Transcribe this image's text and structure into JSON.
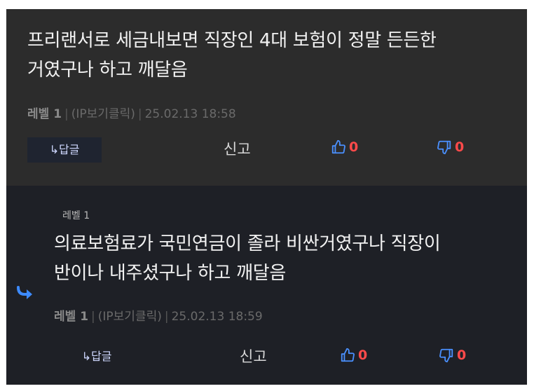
{
  "comments": [
    {
      "text_line1": "프리랜서로 세금내보면 직장인 4대 보험이 정말 든든한",
      "text_line2": "거였구나 하고 깨달음",
      "level": "레벨 1",
      "ip_toggle": "(IP보기클릭)",
      "date": "25.02.13 18:58",
      "reply_label": "↳답글",
      "report_label": "신고",
      "upvotes": "0",
      "downvotes": "0"
    },
    {
      "level_tag": "레벨 1",
      "text_line1": "의료보험료가 국민연금이 졸라 비싼거였구나  직장이",
      "text_line2": "반이나 내주셨구나 하고 깨달음",
      "level": "레벨 1",
      "ip_toggle": "(IP보기클릭)",
      "date": "25.02.13 18:59",
      "reply_label": "↳답글",
      "report_label": "신고",
      "upvotes": "0",
      "downvotes": "0"
    }
  ],
  "colors": {
    "count": "#ff4a4a",
    "thumb_up": "#4a90ff",
    "thumb_down": "#4a90ff",
    "reply_arrow": "#3d8bff"
  },
  "icons": [
    "thumbs-up-icon",
    "thumbs-down-icon",
    "reply-arrow-icon"
  ]
}
